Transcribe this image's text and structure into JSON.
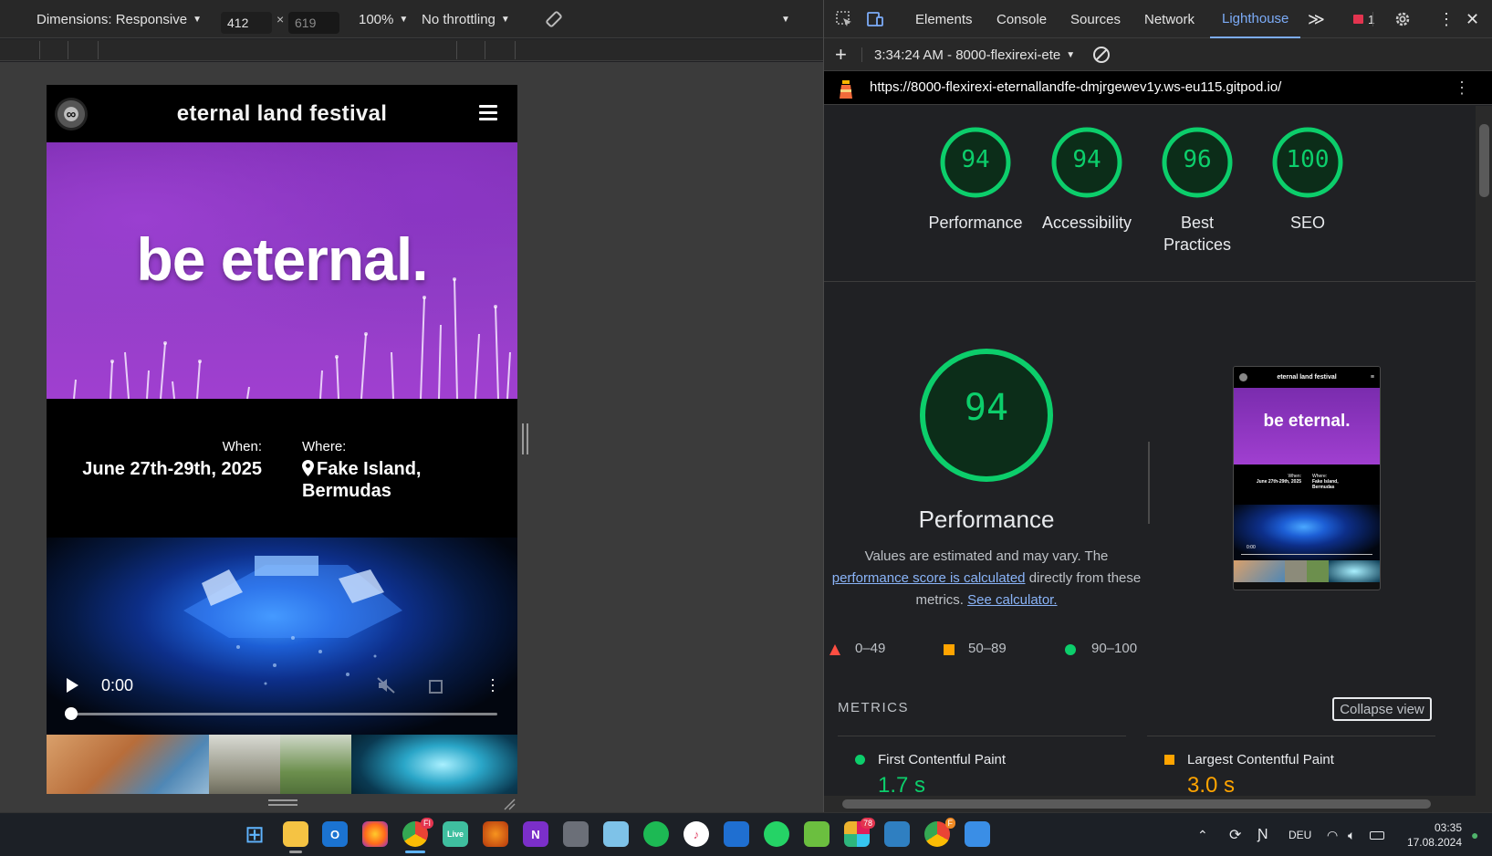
{
  "devtools_device_bar": {
    "dimensions_label": "Dimensions: Responsive",
    "width_value": "412",
    "height_placeholder": "619",
    "times_sign": "×",
    "zoom": "100%",
    "throttling": "No throttling"
  },
  "emulated_site": {
    "site_title": "eternal land festival",
    "logo_text": "∞",
    "hero_heading": "be eternal.",
    "when_label": "When:",
    "when_value": "June 27th-29th, 2025",
    "where_label": "Where:",
    "where_value_line1": "Fake Island,",
    "where_value_line2": "Bermudas",
    "video_time": "0:00",
    "video_progress_fraction": 0
  },
  "devtools_tabs": {
    "items": [
      {
        "label": "Elements"
      },
      {
        "label": "Console"
      },
      {
        "label": "Sources"
      },
      {
        "label": "Network"
      },
      {
        "label": "Lighthouse"
      }
    ],
    "active": "Lighthouse",
    "more_symbol": "≫",
    "issues_count": "1"
  },
  "lighthouse_toolbar": {
    "add_symbol": "+",
    "report_selector": "3:34:24 AM - 8000-flexirexi-ete"
  },
  "report_url": "https://8000-flexirexi-eternallandfe-dmjrgewev1y.ws-eu115.gitpod.io/",
  "category_scores": [
    {
      "label_line1": "Performance",
      "label_line2": "",
      "score": 94
    },
    {
      "label_line1": "Accessibility",
      "label_line2": "",
      "score": 94
    },
    {
      "label_line1": "Best",
      "label_line2": "Practices",
      "score": 96
    },
    {
      "label_line1": "SEO",
      "label_line2": "",
      "score": 100
    }
  ],
  "performance_section": {
    "score": 94,
    "title": "Performance",
    "desc_part1": "Values are estimated and may vary. The",
    "desc_link1": "performance score is calculated",
    "desc_part2": "directly from these metrics.",
    "desc_link2": "See calculator.",
    "legend": [
      {
        "range": "0–49",
        "color": "#ff4e42"
      },
      {
        "range": "50–89",
        "color": "#ffa400"
      },
      {
        "range": "90–100",
        "color": "#0cce6b"
      }
    ],
    "screenshot_site_title": "eternal land festival",
    "screenshot_hero": "be eternal.",
    "screenshot_when_label": "When:",
    "screenshot_when_value": "June 27th-29th, 2025",
    "screenshot_where_label": "Where:",
    "screenshot_where_line1": "Fake Island,",
    "screenshot_where_line2": "Bermudas",
    "screenshot_video_time": "0:00"
  },
  "metrics": {
    "header": "METRICS",
    "collapse_label": "Collapse view",
    "items": [
      {
        "name": "First Contentful Paint",
        "value": "1.7 s",
        "color": "#0cce6b"
      },
      {
        "name": "Largest Contentful Paint",
        "value": "3.0 s",
        "color": "#ffa400"
      }
    ]
  },
  "taskbar": {
    "apps": [
      {
        "name": "start",
        "label": "⊞"
      },
      {
        "name": "file-explorer",
        "label": ""
      },
      {
        "name": "outlook",
        "label": "O"
      },
      {
        "name": "firefox",
        "label": ""
      },
      {
        "name": "chrome",
        "label": "",
        "badge": "FI"
      },
      {
        "name": "live",
        "label": "Live"
      },
      {
        "name": "fl-studio",
        "label": ""
      },
      {
        "name": "onenote",
        "label": "N"
      },
      {
        "name": "calculator",
        "label": ""
      },
      {
        "name": "search-app",
        "label": ""
      },
      {
        "name": "spotify",
        "label": ""
      },
      {
        "name": "itunes",
        "label": "♪"
      },
      {
        "name": "trello",
        "label": ""
      },
      {
        "name": "whatsapp",
        "label": ""
      },
      {
        "name": "notepad",
        "label": ""
      },
      {
        "name": "slack",
        "label": "",
        "badge": "78"
      },
      {
        "name": "monitor",
        "label": ""
      },
      {
        "name": "chrome-2",
        "label": "",
        "badge": "F"
      },
      {
        "name": "paint",
        "label": ""
      }
    ],
    "language": "DEU",
    "time": "03:35",
    "date": "17.08.2024"
  }
}
